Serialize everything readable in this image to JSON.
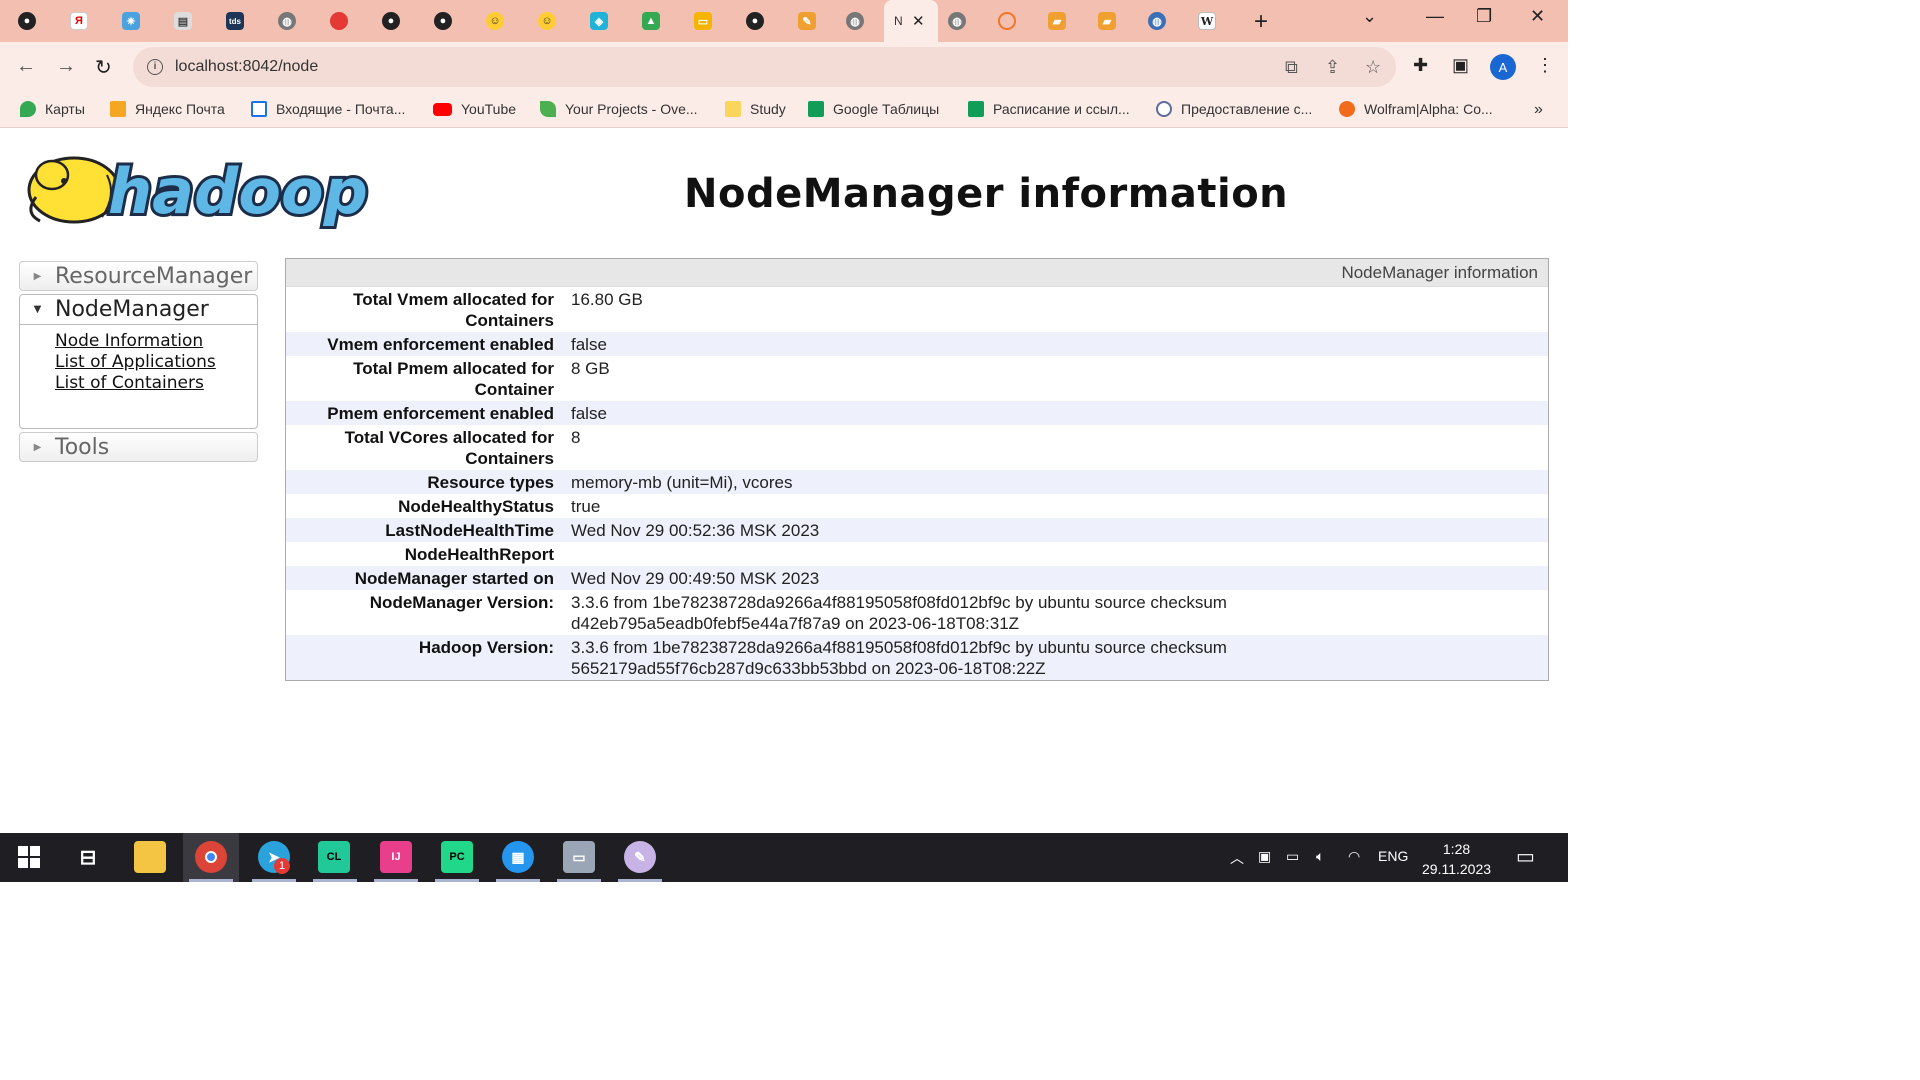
{
  "browser": {
    "active_tab_title": "N",
    "url": "localhost:8042/node",
    "profile_initial": "A",
    "bookmarks": [
      {
        "label": "Карты",
        "color": "#34a853"
      },
      {
        "label": "Яндекс Почта",
        "color": "#f5a623"
      },
      {
        "label": "Входящие - Почта...",
        "color": "#1a73e8"
      },
      {
        "label": "YouTube",
        "color": "#ff0000"
      },
      {
        "label": "Your Projects - Ove...",
        "color": "#4caf50"
      },
      {
        "label": "Study",
        "color": "#f9d65b"
      },
      {
        "label": "Google Таблицы",
        "color": "#0f9d58"
      },
      {
        "label": "Расписание и ссыл...",
        "color": "#0f9d58"
      },
      {
        "label": "Предоставление с...",
        "color": "#5b6b9a"
      },
      {
        "label": "Wolfram|Alpha: Co...",
        "color": "#f26b1d"
      }
    ]
  },
  "page": {
    "title": "NodeManager information",
    "logo_text": "hadoop",
    "nav": {
      "resource_manager": "ResourceManager",
      "node_manager": "NodeManager",
      "links": [
        "Node Information",
        "List of Applications",
        "List of Containers"
      ],
      "tools": "Tools"
    },
    "info": {
      "caption": "NodeManager information",
      "rows": [
        {
          "key": "Total Vmem allocated for Containers",
          "value": "16.80 GB"
        },
        {
          "key": "Vmem enforcement enabled",
          "value": "false"
        },
        {
          "key": "Total Pmem allocated for Container",
          "value": "8 GB"
        },
        {
          "key": "Pmem enforcement enabled",
          "value": "false"
        },
        {
          "key": "Total VCores allocated for Containers",
          "value": "8"
        },
        {
          "key": "Resource types",
          "value": "memory-mb (unit=Mi), vcores"
        },
        {
          "key": "NodeHealthyStatus",
          "value": "true"
        },
        {
          "key": "LastNodeHealthTime",
          "value": "Wed Nov 29 00:52:36 MSK 2023"
        },
        {
          "key": "NodeHealthReport",
          "value": ""
        },
        {
          "key": "NodeManager started on",
          "value": "Wed Nov 29 00:49:50 MSK 2023"
        },
        {
          "key": "NodeManager Version:",
          "value": "3.3.6 from 1be78238728da9266a4f88195058f08fd012bf9c by ubuntu source checksum d42eb795a5eadb0febf5e44a7f87a9 on 2023-06-18T08:31Z"
        },
        {
          "key": "Hadoop Version:",
          "value": "3.3.6 from 1be78238728da9266a4f88195058f08fd012bf9c by ubuntu source checksum 5652179ad55f76cb287d9c633bb53bbd on 2023-06-18T08:22Z"
        }
      ]
    }
  },
  "taskbar": {
    "telegram_badge": "1",
    "language": "ENG",
    "time": "1:28",
    "date": "29.11.2023"
  }
}
